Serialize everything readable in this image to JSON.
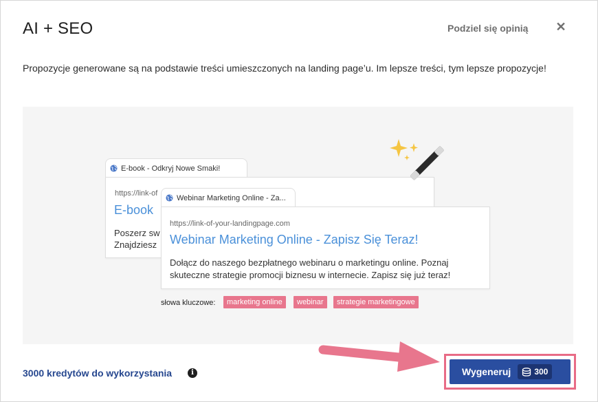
{
  "header": {
    "title": "AI + SEO",
    "feedback_label": "Podziel się opinią",
    "close_symbol": "✕"
  },
  "description": "Propozycje generowane są na podstawie treści umieszczonych na landing page’u. Im lepsze treści, tym lepsze propozycje!",
  "preview": {
    "back_card": {
      "tab_title": "E-book - Odkryj Nowe Smaki!",
      "url": "https://link-of",
      "headline": "E-book",
      "snippet_line1": "Poszerz sw",
      "snippet_line2": "Znajdziesz"
    },
    "front_card": {
      "tab_title": "Webinar Marketing Online - Za...",
      "url": "https://link-of-your-landingpage.com",
      "headline": "Webinar Marketing Online - Zapisz Się Teraz!",
      "snippet": "Dołącz do naszego bezpłatnego webinaru o marketingu online. Poznaj skuteczne strategie promocji biznesu w internecie. Zapisz się już teraz!"
    },
    "keywords_label": "słowa kluczowe:",
    "keywords": [
      "marketing online",
      "webinar",
      "strategie marketingowe"
    ],
    "wand_icon": "magic-wand-icon"
  },
  "footer": {
    "credits_text": "3000 kredytów do wykorzystania",
    "info_symbol": "i",
    "generate_label": "Wygeneruj",
    "generate_cost": "300",
    "coins_icon": "coins-icon"
  },
  "colors": {
    "accent": "#2a4ea0",
    "highlight": "#e86b86",
    "keyword_bg": "#e8768d",
    "link": "#4a90d9",
    "credits_text": "#26478f"
  }
}
